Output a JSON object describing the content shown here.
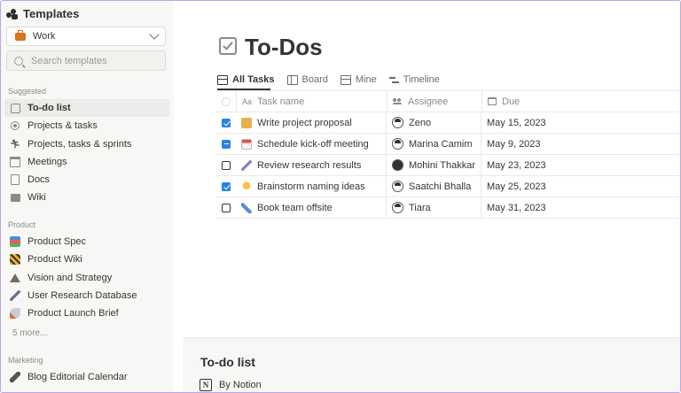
{
  "sidebar": {
    "title": "Templates",
    "workspace": "Work",
    "search_placeholder": "Search templates",
    "sections": [
      {
        "label": "Suggested"
      },
      {
        "label": "Product"
      },
      {
        "label": "Marketing"
      }
    ],
    "suggested": [
      {
        "label": "To-do list",
        "icon": "checkbox-icon"
      },
      {
        "label": "Projects & tasks",
        "icon": "target-icon"
      },
      {
        "label": "Projects, tasks & sprints",
        "icon": "runner-icon"
      },
      {
        "label": "Meetings",
        "icon": "calendar-icon"
      },
      {
        "label": "Docs",
        "icon": "document-icon"
      },
      {
        "label": "Wiki",
        "icon": "book-icon"
      }
    ],
    "product": [
      {
        "label": "Product Spec",
        "icon": "books-emoji-icon"
      },
      {
        "label": "Product Wiki",
        "icon": "construction-emoji-icon"
      },
      {
        "label": "Vision and Strategy",
        "icon": "mountain-emoji-icon"
      },
      {
        "label": "User Research Database",
        "icon": "microscope-emoji-icon"
      },
      {
        "label": "Product Launch Brief",
        "icon": "rocket-emoji-icon"
      }
    ],
    "more": "5 more...",
    "marketing": [
      {
        "label": "Blog Editorial Calendar",
        "icon": "pen-emoji-icon"
      }
    ]
  },
  "page": {
    "title": "To-Dos",
    "tabs": [
      {
        "label": "All Tasks"
      },
      {
        "label": "Board"
      },
      {
        "label": "Mine"
      },
      {
        "label": "Timeline"
      }
    ]
  },
  "table": {
    "columns": [
      "Task name",
      "Assignee",
      "Due"
    ],
    "rows": [
      {
        "state": "checked",
        "task": "Write project proposal",
        "assignee": "Zeno",
        "due": "May 15, 2023",
        "emoji": "writing-hand-icon",
        "color": "#e8b04a"
      },
      {
        "state": "partial",
        "task": "Schedule kick-off meeting",
        "assignee": "Marina Camim",
        "due": "May 9, 2023",
        "emoji": "calendar-emoji-icon",
        "color": "#d9534f"
      },
      {
        "state": "unchecked",
        "task": "Review research results",
        "assignee": "Mohini Thakkar",
        "due": "May 23, 2023",
        "emoji": "microscope-emoji-icon",
        "color": "#8e7cc3"
      },
      {
        "state": "checked",
        "task": "Brainstorm naming ideas",
        "assignee": "Saatchi Bhalla",
        "due": "May 25, 2023",
        "emoji": "lightbulb-emoji-icon",
        "color": "#f4c542"
      },
      {
        "state": "unchecked",
        "task": "Book team offsite",
        "assignee": "Tiara",
        "due": "May 31, 2023",
        "emoji": "airplane-emoji-icon",
        "color": "#5b8dd6"
      }
    ]
  },
  "card": {
    "title": "To-do list",
    "author": "By Notion",
    "logo_letter": "N"
  },
  "colors": {
    "accent": "#2383e2",
    "sidebar_bg": "#f7f7f5",
    "frame_border": "#b9a6e8"
  }
}
